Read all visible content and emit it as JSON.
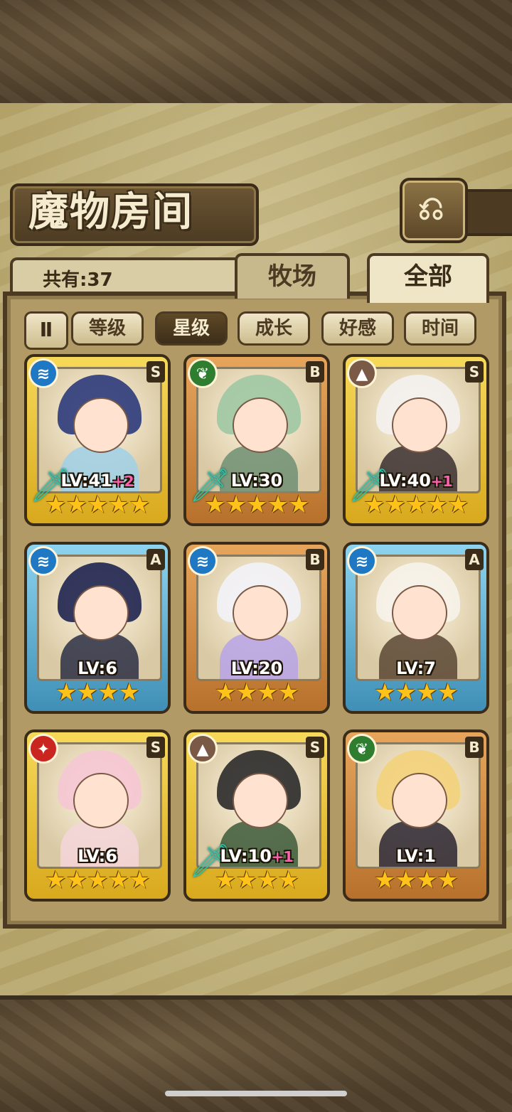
{
  "header": {
    "title": "魔物房间",
    "back_icon": "⎌"
  },
  "summary": {
    "count_label": "共有:37"
  },
  "tabs": [
    {
      "label": "牧场",
      "active": false
    },
    {
      "label": "全部",
      "active": true
    }
  ],
  "sort": {
    "toggle_label": "Ⅱ",
    "options": [
      {
        "label": "等级",
        "active": false
      },
      {
        "label": "星级",
        "active": true
      },
      {
        "label": "成长",
        "active": false
      },
      {
        "label": "好感",
        "active": false
      },
      {
        "label": "时间",
        "active": false
      }
    ]
  },
  "monsters": [
    {
      "element": "water",
      "rank": "S",
      "level": "LV:41",
      "bonus": "+2",
      "stars": "★★★★★",
      "frame": "gold",
      "weapon": true,
      "hair": "#2b3a7a",
      "body": "#9fd0e8"
    },
    {
      "element": "wood",
      "rank": "B",
      "level": "LV:30",
      "bonus": "",
      "stars": "★★★★★",
      "frame": "bronze",
      "weapon": true,
      "hair": "#9fc7a3",
      "body": "#6f8f74"
    },
    {
      "element": "earth",
      "rank": "S",
      "level": "LV:40",
      "bonus": "+1",
      "stars": "★★★★★",
      "frame": "gold",
      "weapon": true,
      "hair": "#f4f1ee",
      "body": "#3a2f2f"
    },
    {
      "element": "water",
      "rank": "A",
      "level": "LV:6",
      "bonus": "",
      "stars": "★★★★",
      "frame": "blue",
      "weapon": false,
      "hair": "#1f2450",
      "body": "#2c2f45"
    },
    {
      "element": "water",
      "rank": "B",
      "level": "LV:20",
      "bonus": "",
      "stars": "★★★★",
      "frame": "bronze",
      "weapon": false,
      "hair": "#f2f2f7",
      "body": "#b7a3e8"
    },
    {
      "element": "water",
      "rank": "A",
      "level": "LV:7",
      "bonus": "",
      "stars": "★★★★",
      "frame": "blue",
      "weapon": false,
      "hair": "#f7f3ea",
      "body": "#5a4634"
    },
    {
      "element": "fire",
      "rank": "S",
      "level": "LV:6",
      "bonus": "",
      "stars": "★★★★★",
      "frame": "gold",
      "weapon": false,
      "hair": "#f6c7d4",
      "body": "#f4d6da"
    },
    {
      "element": "earth",
      "rank": "S",
      "level": "LV:10",
      "bonus": "+1",
      "stars": "★★★★",
      "frame": "gold",
      "weapon": true,
      "hair": "#2a2a2a",
      "body": "#3c5a3a"
    },
    {
      "element": "wood",
      "rank": "B",
      "level": "LV:1",
      "bonus": "",
      "stars": "★★★★",
      "frame": "bronze",
      "weapon": false,
      "hair": "#f3d27a",
      "body": "#2a2530"
    }
  ],
  "element_glyphs": {
    "water": "≋",
    "wood": "❦",
    "earth": "▲",
    "fire": "✦"
  },
  "colors": {
    "gold_frame": "#e8c23a",
    "bronze_frame": "#d48a3e",
    "blue_frame": "#5fb1d6",
    "star": "#ffc21a",
    "bonus": "#ff5fb0"
  }
}
